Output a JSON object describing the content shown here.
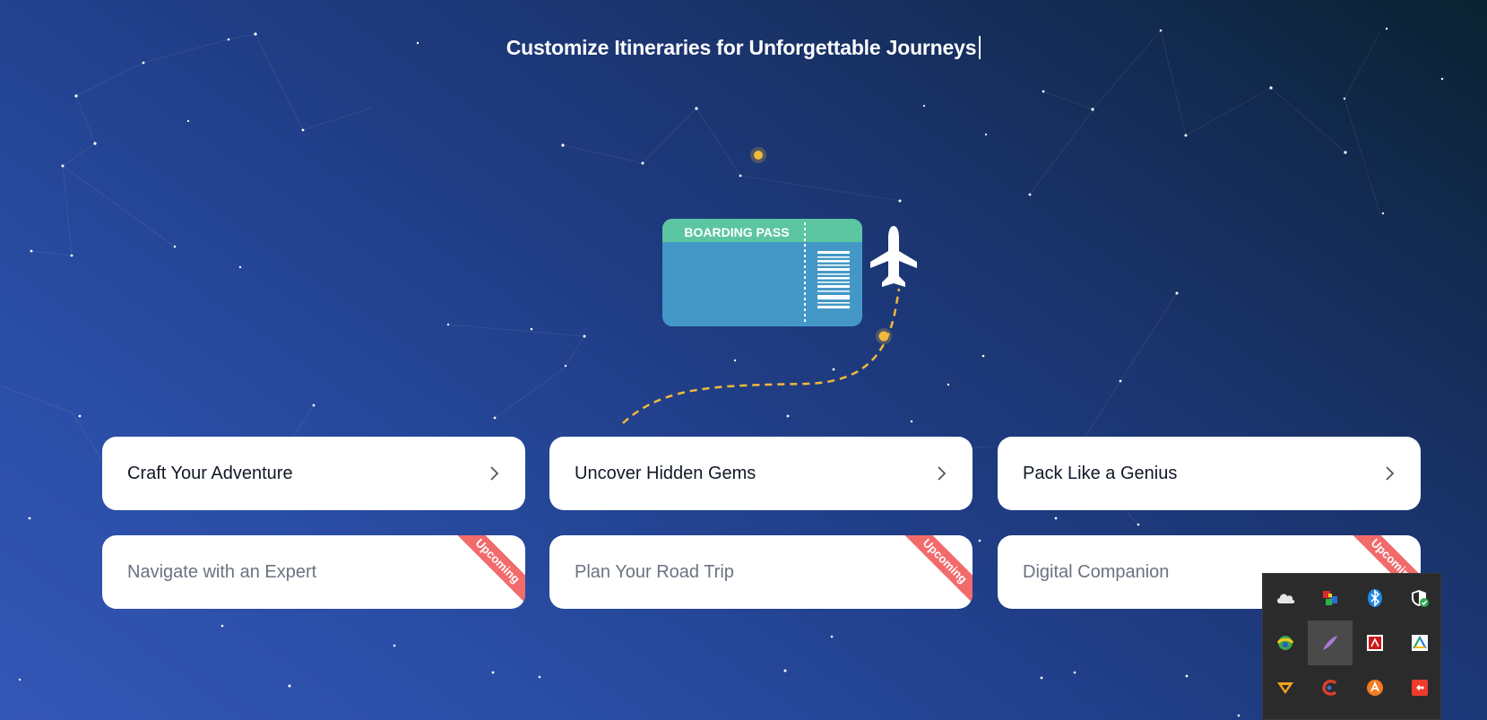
{
  "headline": "Customize Itineraries for Unforgettable Journeys",
  "boarding_pass": {
    "label": "BOARDING PASS"
  },
  "cards": [
    {
      "label": "Craft Your Adventure",
      "icon": "chevron-right-icon"
    },
    {
      "label": "Uncover Hidden Gems",
      "icon": "chevron-right-icon"
    },
    {
      "label": "Pack Like a Genius",
      "icon": "chevron-right-icon"
    },
    {
      "label": "Navigate with an Expert",
      "badge": "Upcoming"
    },
    {
      "label": "Plan Your Road Trip",
      "badge": "Upcoming"
    },
    {
      "label": "Digital Companion",
      "badge": "Upcoming"
    }
  ],
  "tray_icons": [
    "onedrive-icon",
    "network-app-icon",
    "bluetooth-icon",
    "windows-security-icon",
    "globe-app-icon",
    "quill-app-icon",
    "adobe-icon",
    "google-drive-icon",
    "vpn-icon",
    "ccleaner-icon",
    "avast-icon",
    "anydesk-icon"
  ],
  "colors": {
    "accent_green": "#5cc5a1",
    "ticket_blue": "#4398c7",
    "path_yellow": "#f1b93a",
    "ribbon_red": "#f26b6b"
  }
}
